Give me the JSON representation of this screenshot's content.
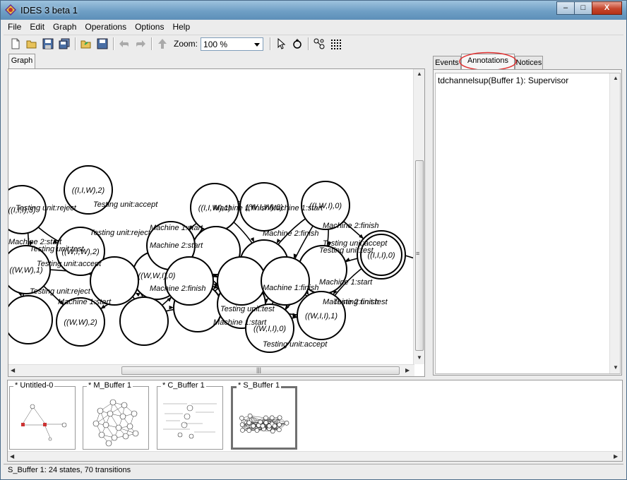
{
  "window": {
    "title": "IDES 3 beta 1",
    "buttons": {
      "minimize": "–",
      "maximize": "□",
      "close": "X"
    }
  },
  "menubar": {
    "items": [
      "File",
      "Edit",
      "Graph",
      "Operations",
      "Options",
      "Help"
    ]
  },
  "toolbar": {
    "icons": [
      "new-file-icon",
      "open-folder-icon",
      "save-icon",
      "save-all-icon",
      "open-workspace-icon",
      "save-workspace-icon",
      "undo-icon",
      "redo-icon",
      "move-up-icon",
      "select-pointer-icon",
      "create-state-icon",
      "layout-icon",
      "grid-icon"
    ],
    "zoom_label": "Zoom:",
    "zoom_value": "100 %"
  },
  "graph_panel": {
    "tab_label": "Graph",
    "node_labels": [
      "((I,I,W),2)",
      "((I,I,I),3)",
      "((I,I,W),1)",
      "((W,I,W),0)",
      "((I,W,I),0)",
      "((I,I,I),0)",
      "((W,I,W),2)",
      "((W,W),1)",
      "((W,W,I),0)",
      "((W,W),2)",
      "((W,I,I),0)",
      "((W,I,I),1)"
    ],
    "edge_labels": [
      "Testing unit:reject",
      "Testing unit:accept",
      "Machine 1:finish",
      "Machine 1:start",
      "Machine 2:finish",
      "Machine 2:start",
      "Testing unit:test",
      "Machine 2:finish",
      "Testing unit:accept",
      "Testing unit:test",
      "Machine 1:start",
      "Testing unit:reject",
      "Machine 1:start",
      "Testing unit:reject",
      "Testing unit:test",
      "Machine 2:start",
      "Testing unit:accept",
      "Machine 1:finish",
      "Machine 1:start",
      "Machine 2:finish",
      "Testing unit:test",
      "Machine 1:start",
      "Testing unit:accept",
      "Machine 2:finish"
    ]
  },
  "right_panel": {
    "tabs": [
      "Events",
      "Annotations",
      "Notices"
    ],
    "active_tab": "Annotations",
    "annotation_text": "tdchannelsup(Buffer 1): Supervisor"
  },
  "thumbnails": [
    {
      "label": "* Untitled-0"
    },
    {
      "label": "* M_Buffer 1"
    },
    {
      "label": "* C_Buffer 1"
    },
    {
      "label": "* S_Buffer 1"
    }
  ],
  "status": {
    "text": "S_Buffer 1:  24 states,  70 transitions"
  },
  "colors": {
    "annotation_highlight": "#e03030"
  }
}
